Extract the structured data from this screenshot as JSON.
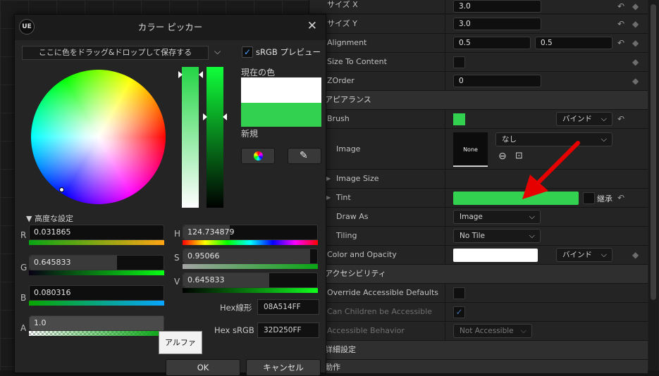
{
  "details": {
    "rows": [
      {
        "label": "サイズ X",
        "value": "3.0"
      },
      {
        "label": "サイズ Y",
        "value": "3.0"
      },
      {
        "label": "Alignment",
        "value1": "0.5",
        "value2": "0.5"
      },
      {
        "label": "Size To Content"
      },
      {
        "label": "ZOrder",
        "value": "0"
      }
    ],
    "appearance_header": "アピアランス",
    "brush_label": "Brush",
    "bind_label": "バインド",
    "image_label": "Image",
    "image_none": "なし",
    "thumb_none": "None",
    "image_size_label": "Image Size",
    "tint_label": "Tint",
    "inherit_label": "継承",
    "draw_as_label": "Draw As",
    "draw_as_value": "Image",
    "tiling_label": "Tiling",
    "tiling_value": "No Tile",
    "color_opacity_label": "Color and Opacity",
    "accessibility_header": "アクセシビリティ",
    "override_label": "Override Accessible Defaults",
    "can_children_label": "Can Children be Accessible",
    "behavior_label": "Accessible Behavior",
    "behavior_value": "Not Accessible",
    "detail_settings": "詳細設定",
    "action": "動作"
  },
  "picker": {
    "title": "カラー ピッカー",
    "logo": "UE",
    "preset_placeholder": "ここに色をドラッグ&ドロップして保存する",
    "srgb_preview": "sRGB プレビュー",
    "current_color": "現在の色",
    "new_color": "新規",
    "advanced": "高度な設定",
    "channels": {
      "R": {
        "label": "R",
        "value": "0.031865"
      },
      "G": {
        "label": "G",
        "value": "0.645833"
      },
      "B": {
        "label": "B",
        "value": "0.080316"
      },
      "A": {
        "label": "A",
        "value": "1.0"
      },
      "H": {
        "label": "H",
        "value": "124.734879"
      },
      "S": {
        "label": "S",
        "value": "0.95066"
      },
      "V": {
        "label": "V",
        "value": "0.645833"
      }
    },
    "hex_linear_label": "Hex線形",
    "hex_linear": "08A514FF",
    "hex_srgb_label": "Hex sRGB",
    "hex_srgb": "32D250FF",
    "alpha_tooltip": "アルファ",
    "ok": "OK",
    "cancel": "キャンセル"
  },
  "colors": {
    "tint": "#32d250",
    "brush": "#32d250",
    "arrow": "#e60000"
  }
}
